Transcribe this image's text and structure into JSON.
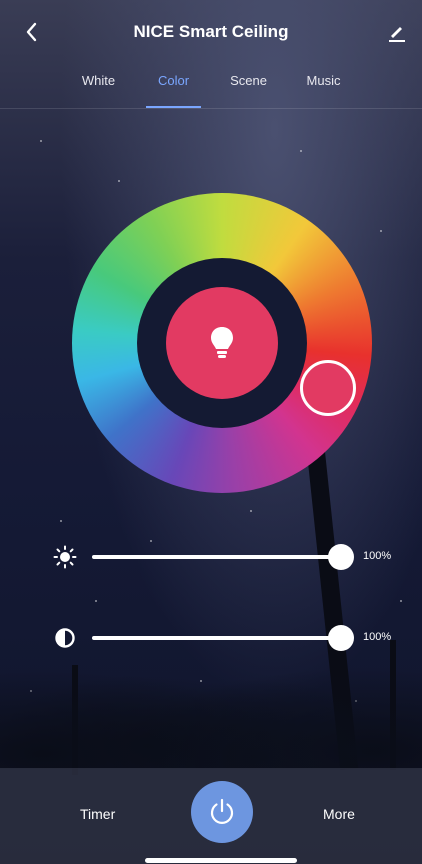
{
  "header": {
    "title": "NICE Smart Ceiling",
    "back_icon": "chevron-left-icon",
    "edit_icon": "pencil-icon"
  },
  "tabs": [
    {
      "label": "White",
      "active": false
    },
    {
      "label": "Color",
      "active": true
    },
    {
      "label": "Scene",
      "active": false
    },
    {
      "label": "Music",
      "active": false
    }
  ],
  "color_wheel": {
    "selected_color": "#e23a62",
    "center_icon": "lightbulb-icon"
  },
  "sliders": [
    {
      "icon": "sun-icon",
      "value_label": "100%",
      "value": 1.0
    },
    {
      "icon": "contrast-icon",
      "value_label": "100%",
      "value": 1.0
    }
  ],
  "bottom_bar": {
    "timer_label": "Timer",
    "power_icon": "power-icon",
    "more_label": "More"
  },
  "colors": {
    "accent": "#7aa6ff",
    "power_button": "#6d96e0"
  }
}
